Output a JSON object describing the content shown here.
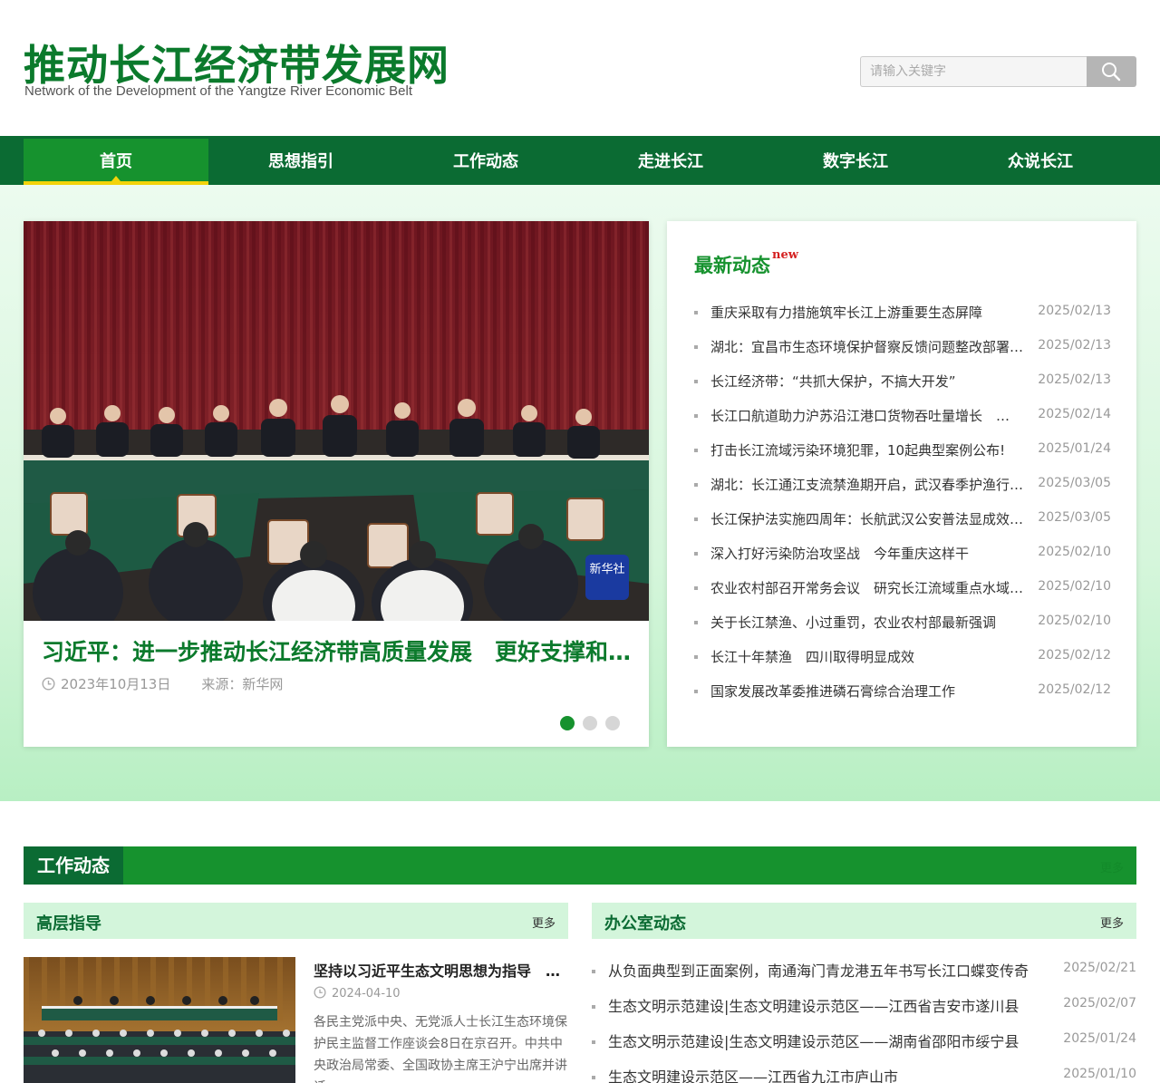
{
  "header": {
    "logo_cn": "推动长江经济带发展网",
    "logo_en": "Network of the Development of the Yangtze River Economic Belt",
    "search_placeholder": "请输入关键字",
    "search_icon": "search-icon"
  },
  "nav": {
    "items": [
      {
        "label": "首页",
        "active": true
      },
      {
        "label": "思想指引"
      },
      {
        "label": "工作动态"
      },
      {
        "label": "走进长江"
      },
      {
        "label": "数字长江"
      },
      {
        "label": "众说长江"
      }
    ]
  },
  "carousel": {
    "title": "习近平：进一步推动长江经济带高质量发展　更好支撑和服务中国式现代化",
    "date": "2023年10月13日",
    "source": "来源：新华网",
    "watermark": "新华社",
    "dots": 3,
    "active_dot": 0
  },
  "latest": {
    "title": "最新动态",
    "badge": "new",
    "items": [
      {
        "title": "重庆采取有力措施筑牢长江上游重要生态屏障",
        "date": "2025/02/13"
      },
      {
        "title": "湖北：宜昌市生态环境保护督察反馈问题整改部署会召开",
        "date": "2025/02/13"
      },
      {
        "title": "长江经济带：“共抓大保护，不搞大开发”",
        "date": "2025/02/13"
      },
      {
        "title": "长江口航道助力沪苏沿江港口货物吞吐量增长　…",
        "date": "2025/02/14"
      },
      {
        "title": "打击长江流域污染环境犯罪，10起典型案例公布!",
        "date": "2025/01/24"
      },
      {
        "title": "湖北：长江通江支流禁渔期开启，武汉春季护渔行动启动",
        "date": "2025/03/05"
      },
      {
        "title": "长江保护法实施四周年：长航武汉公安普法显成效实效",
        "date": "2025/03/05"
      },
      {
        "title": "深入打好污染防治攻坚战　今年重庆这样干",
        "date": "2025/02/10"
      },
      {
        "title": "农业农村部召开常务会议　研究长江流域重点水域禁捕",
        "date": "2025/02/10"
      },
      {
        "title": "关于长江禁渔、小过重罚，农业农村部最新强调",
        "date": "2025/02/10"
      },
      {
        "title": "长江十年禁渔　四川取得明显成效",
        "date": "2025/02/12"
      },
      {
        "title": "国家发展改革委推进磷石膏综合治理工作",
        "date": "2025/02/12"
      }
    ]
  },
  "work": {
    "title": "工作动态",
    "more": "更多",
    "leader": {
      "title": "高层指导",
      "more": "更多",
      "feature_title": "坚持以习近平生态文明思想为指导　…",
      "feature_date": "2024-04-10",
      "feature_text": "各民主党派中央、无党派人士长江生态环境保护民主监督工作座谈会8日在京召开。中共中央政治局常委、全国政协主席王沪宁出席并讲话。"
    },
    "office": {
      "title": "办公室动态",
      "more": "更多",
      "items": [
        {
          "title": "从负面典型到正面案例，南通海门青龙港五年书写长江口蝶变传奇",
          "date": "2025/02/21"
        },
        {
          "title": "生态文明示范建设|生态文明建设示范区——江西省吉安市遂川县",
          "date": "2025/02/07"
        },
        {
          "title": "生态文明示范建设|生态文明建设示范区——湖南省邵阳市绥宁县",
          "date": "2025/01/24"
        },
        {
          "title": "生态文明建设示范区——江西省九江市庐山市",
          "date": "2025/01/10"
        }
      ]
    }
  },
  "colors": {
    "brand_dark": "#0b6b33",
    "brand": "#16922e",
    "accent": "#f3d30a",
    "badge_red": "#d42020"
  }
}
